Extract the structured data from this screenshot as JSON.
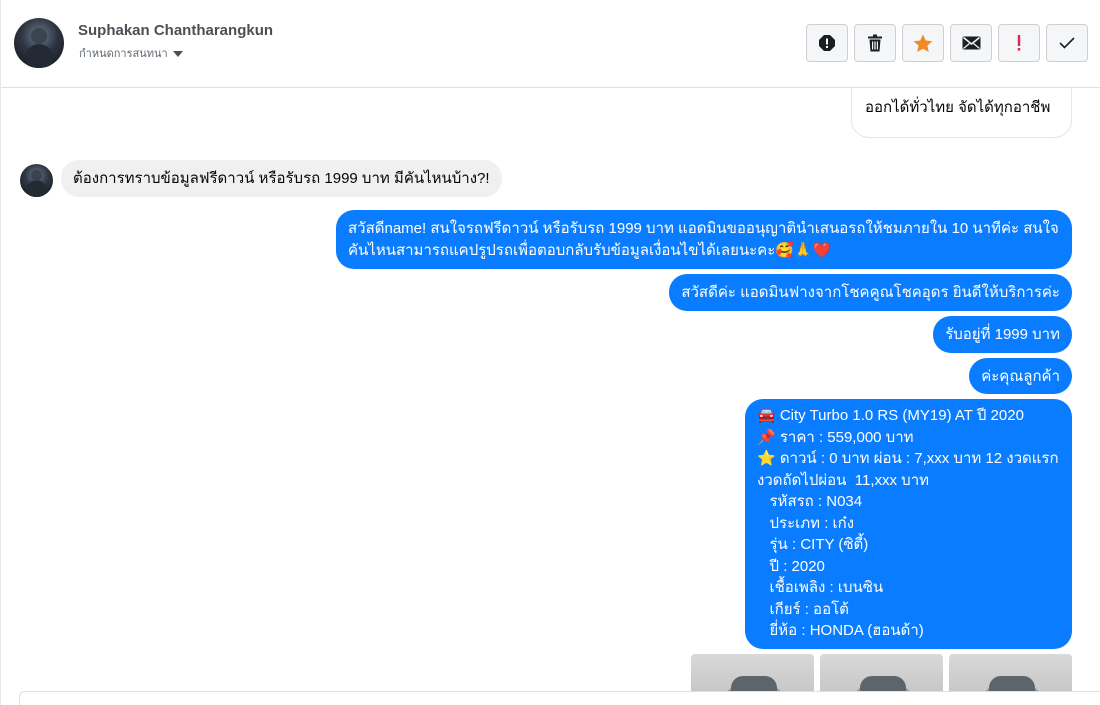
{
  "header": {
    "contact_name": "Suphakan Chantharangkun",
    "assign_label": "กำหนดการสนทนา",
    "actions": [
      {
        "name": "report-icon",
        "color": "#1c1e21"
      },
      {
        "name": "trash-icon",
        "color": "#1c1e21"
      },
      {
        "name": "star-icon",
        "color": "#f08a24"
      },
      {
        "name": "envelope-icon",
        "color": "#1c1e21"
      },
      {
        "name": "exclamation-icon",
        "color": "#e0245e"
      },
      {
        "name": "check-icon",
        "color": "#1c1e21"
      }
    ]
  },
  "messages": {
    "partial_top": "ออกได้ทั่วไทย จัดได้ทุกอาชีพ",
    "incoming_1": "ต้องการทราบข้อมูลฟรีดาวน์ หรือรับรถ 1999 บาท มีคันไหนบ้าง?!",
    "outgoing_1_line1": "สวัสดีname! สนใจรถฟรีดาวน์ หรือรับรถ 1999 บาท แอดมินขออนุญาตินำเสนอรถให้ชมภายใน 10 นาทีค่ะ สนใจ",
    "outgoing_1_line2": "คันไหนสามารถแคปรูปรถเพื่อตอบกลับรับข้อมูลเงื่อนไขได้เลยนะคะ🥰🙏❤️",
    "outgoing_2": "สวัสดีค่ะ แอดมินฟางจากโชคคูณโชคอุดร ยินดีให้บริการค่ะ",
    "outgoing_3": "รับอยู่ที่  1999  บาท",
    "outgoing_4": "ค่ะคุณลูกค้า",
    "car_card": [
      "🚘 City Turbo 1.0 RS (MY19) AT ปี 2020",
      "📌 ราคา : 559,000 บาท",
      "⭐ ดาวน์ : 0 บาท ผ่อน : 7,xxx บาท 12 งวดแรก",
      "งวดถัดไปผ่อน  11,xxx บาท",
      "   รหัสรถ : N034",
      "   ประเภท : เก๋ง",
      "   รุ่น : CITY (ซิตี้)",
      "   ปี : 2020",
      "   เชื้อเพลิง : เบนซิน",
      "   เกียร์ : ออโต้",
      "   ยี่ห้อ : HONDA (ฮอนด้า)"
    ]
  },
  "colors": {
    "outgoing_bubble": "#0a7cff",
    "incoming_bubble": "#f0f0f0"
  }
}
